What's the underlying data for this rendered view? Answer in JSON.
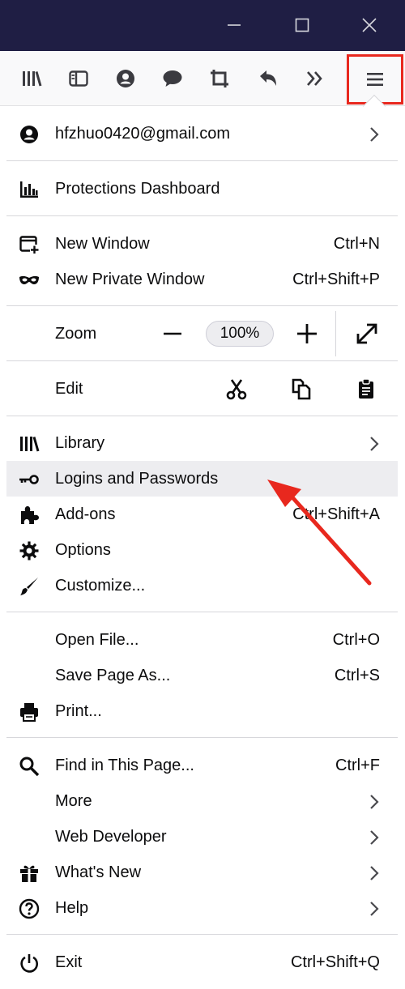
{
  "window": {
    "minimize_icon": "minimize-icon",
    "maximize_icon": "maximize-icon",
    "close_icon": "close-icon"
  },
  "toolbar": {
    "icons": [
      "library-icon",
      "sidebar-icon",
      "account-icon",
      "chat-icon",
      "crop-icon",
      "undo-icon",
      "overflow-chevrons-icon",
      "hamburger-menu-icon"
    ],
    "highlight_color": "#e8281e"
  },
  "menu": {
    "account": {
      "label": "hfzhuo0420@gmail.com"
    },
    "protections": {
      "label": "Protections Dashboard"
    },
    "new_window": {
      "label": "New Window",
      "shortcut": "Ctrl+N"
    },
    "new_private_window": {
      "label": "New Private Window",
      "shortcut": "Ctrl+Shift+P"
    },
    "zoom": {
      "label": "Zoom",
      "minus": "−",
      "value": "100%",
      "plus": "+"
    },
    "edit": {
      "label": "Edit"
    },
    "library": {
      "label": "Library"
    },
    "logins": {
      "label": "Logins and Passwords"
    },
    "addons": {
      "label": "Add-ons",
      "shortcut": "Ctrl+Shift+A"
    },
    "options": {
      "label": "Options"
    },
    "customize": {
      "label": "Customize..."
    },
    "open_file": {
      "label": "Open File...",
      "shortcut": "Ctrl+O"
    },
    "save_page": {
      "label": "Save Page As...",
      "shortcut": "Ctrl+S"
    },
    "print": {
      "label": "Print..."
    },
    "find": {
      "label": "Find in This Page...",
      "shortcut": "Ctrl+F"
    },
    "more": {
      "label": "More"
    },
    "web_developer": {
      "label": "Web Developer"
    },
    "whats_new": {
      "label": "What's New"
    },
    "help": {
      "label": "Help"
    },
    "exit": {
      "label": "Exit",
      "shortcut": "Ctrl+Shift+Q"
    }
  },
  "colors": {
    "titlebar": "#1f1e44",
    "annotation": "#e8281e",
    "hover_row": "#ededf0"
  }
}
